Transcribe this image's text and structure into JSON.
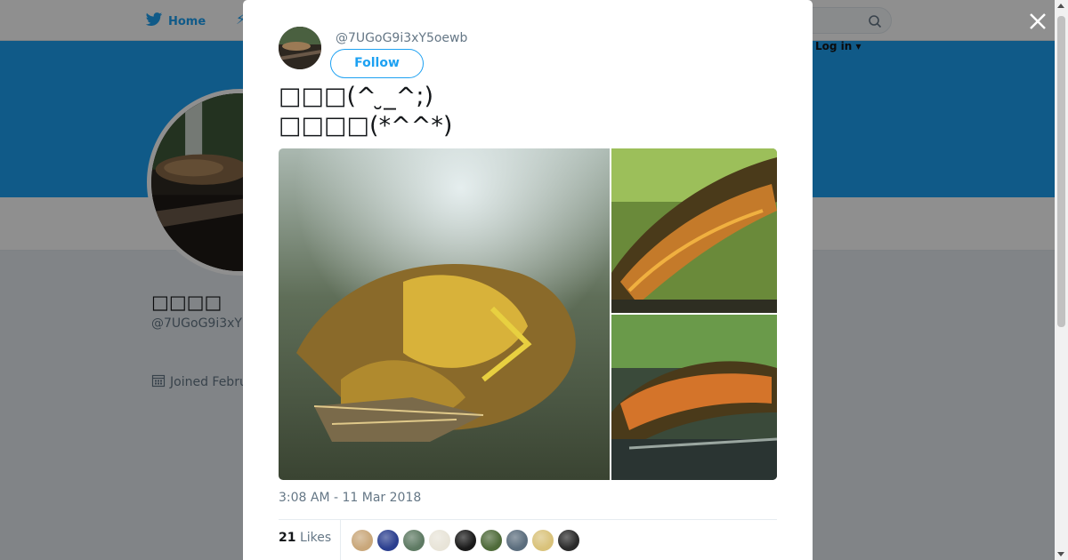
{
  "nav": {
    "home_label": "Home",
    "login_label": "Log in ▾"
  },
  "profile": {
    "name": "□□□□",
    "handle": "@7UGoG9i3xY",
    "joined": "Joined Febru"
  },
  "tweet": {
    "handle": "@7UGoG9i3xY5oewb",
    "follow_label": "Follow",
    "text": "□□□(^ ̮_^;)\n□□□□(*^^*)",
    "timestamp": "3:08 AM - 11 Mar 2018",
    "likes_count": "21",
    "likes_label": "Likes",
    "likers": [
      {
        "color": "#c9a77a"
      },
      {
        "color": "#2b3f8f"
      },
      {
        "color": "#5e7a63"
      },
      {
        "color": "#e8e4d8"
      },
      {
        "color": "#1a1a1a"
      },
      {
        "color": "#4f6b3a"
      },
      {
        "color": "#5b6d7d"
      },
      {
        "color": "#d9c27a"
      },
      {
        "color": "#2a2a2a"
      }
    ]
  },
  "colors": {
    "accent": "#1da1f2",
    "banner": "#1da1f2"
  },
  "icons": {
    "close": "close-icon",
    "search": "search-icon",
    "calendar": "calendar-icon",
    "bird": "twitter-bird-icon"
  }
}
